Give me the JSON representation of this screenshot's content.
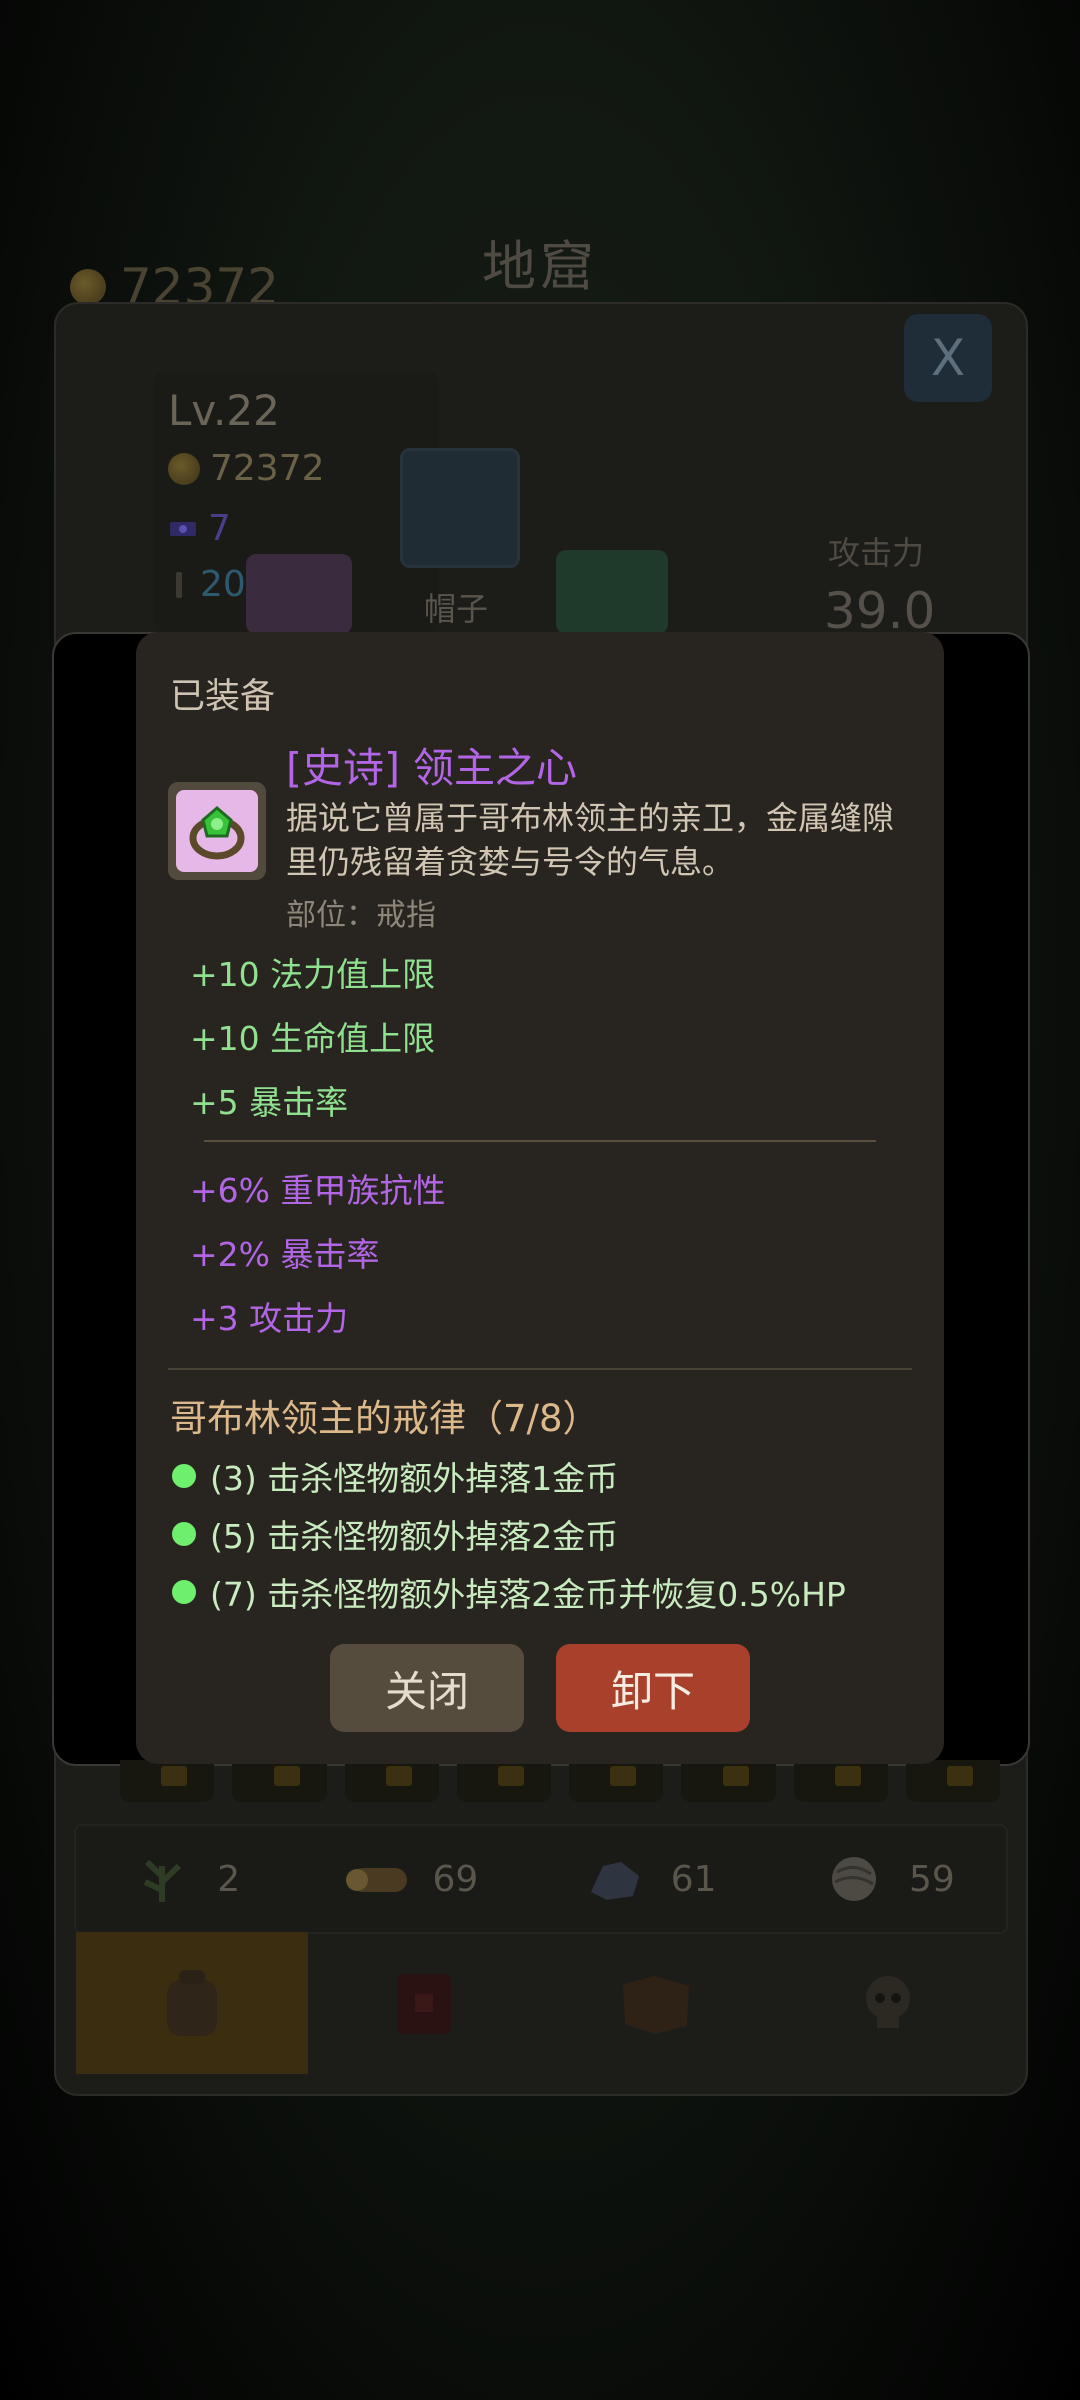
{
  "background": {
    "title": "地窟",
    "top_gold": "72372",
    "close_label": "X",
    "stats": {
      "level": "Lv.22",
      "gold": "72372",
      "gems": "7",
      "keys": "20"
    },
    "hat_label": "帽子",
    "attack_label": "攻击力",
    "attack_value": "39.0",
    "resources": [
      {
        "icon": "herb-icon",
        "count": "2"
      },
      {
        "icon": "wood-log-icon",
        "count": "69"
      },
      {
        "icon": "ore-icon",
        "count": "61"
      },
      {
        "icon": "wool-icon",
        "count": "59"
      }
    ],
    "nav_tabs": [
      {
        "icon": "backpack-icon",
        "active": true
      },
      {
        "icon": "book-icon",
        "active": false
      },
      {
        "icon": "map-icon",
        "active": false
      },
      {
        "icon": "skull-icon",
        "active": false
      }
    ]
  },
  "item_modal": {
    "status": "已装备",
    "name": "[史诗] 领主之心",
    "description": "据说它曾属于哥布林领主的亲卫，金属缝隙里仍残留着贪婪与号令的气息。",
    "slot": "部位：戒指",
    "icon": "ring-icon",
    "base_stats": [
      "+10 法力值上限",
      "+10 生命值上限",
      "+5 暴击率"
    ],
    "bonus_stats": [
      "+6% 重甲族抗性",
      "+2% 暴击率",
      "+3 攻击力"
    ],
    "set_title": "哥布林领主的戒律（7/8）",
    "set_bonuses": [
      "(3) 击杀怪物额外掉落1金币",
      "(5) 击杀怪物额外掉落2金币",
      "(7) 击杀怪物额外掉落2金币并恢复0.5%HP"
    ],
    "close_button": "关闭",
    "unequip_button": "卸下"
  },
  "colors": {
    "epic_purple": "#b266e6",
    "stat_green": "#8fe08f",
    "set_gold": "#dcb88a",
    "unequip_red": "#a8402c",
    "close_brown": "#564c3e"
  }
}
